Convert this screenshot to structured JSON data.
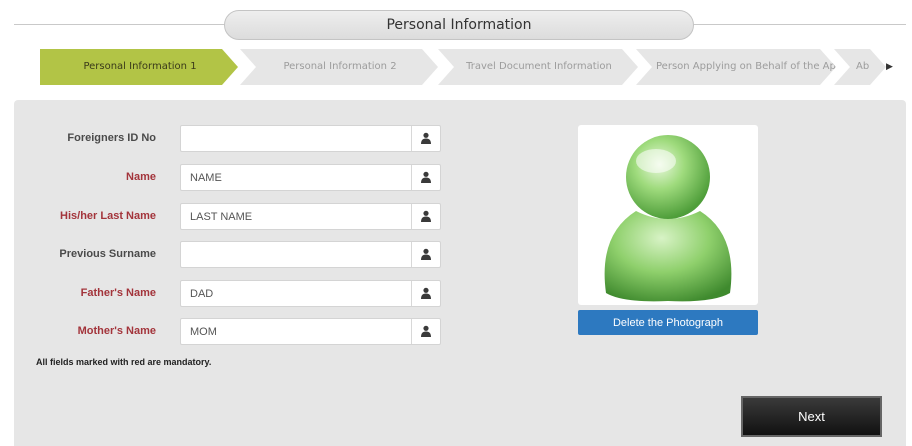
{
  "header": {
    "title": "Personal Information"
  },
  "steps": [
    {
      "label": "Personal Information 1",
      "active": true
    },
    {
      "label": "Personal Information 2",
      "active": false
    },
    {
      "label": "Travel Document Information",
      "active": false
    },
    {
      "label": "Person Applying on Behalf of the Applicant",
      "active": false
    },
    {
      "label": "Ab",
      "active": false
    }
  ],
  "form": {
    "fields": [
      {
        "label": "Foreigners ID No",
        "value": "",
        "required": false
      },
      {
        "label": "Name",
        "value": "NAME",
        "required": true
      },
      {
        "label": "His/her Last Name",
        "value": "LAST NAME",
        "required": true
      },
      {
        "label": "Previous Surname",
        "value": "",
        "required": false
      },
      {
        "label": "Father's Name",
        "value": "DAD",
        "required": true
      },
      {
        "label": "Mother's Name",
        "value": "MOM",
        "required": true
      }
    ],
    "mandatory_note": "All fields marked with red are mandatory."
  },
  "photo": {
    "delete_label": "Delete the Photograph",
    "icon": "user-avatar-icon"
  },
  "next_label": "Next",
  "colors": {
    "active_step": "#b2c446",
    "mandatory_label": "#a3343b",
    "delete_button": "#2d79c0",
    "next_button": "#1a1a1a"
  },
  "icons": {
    "field_icon": "user-icon",
    "steps_scroll": "right-arrow-icon"
  }
}
